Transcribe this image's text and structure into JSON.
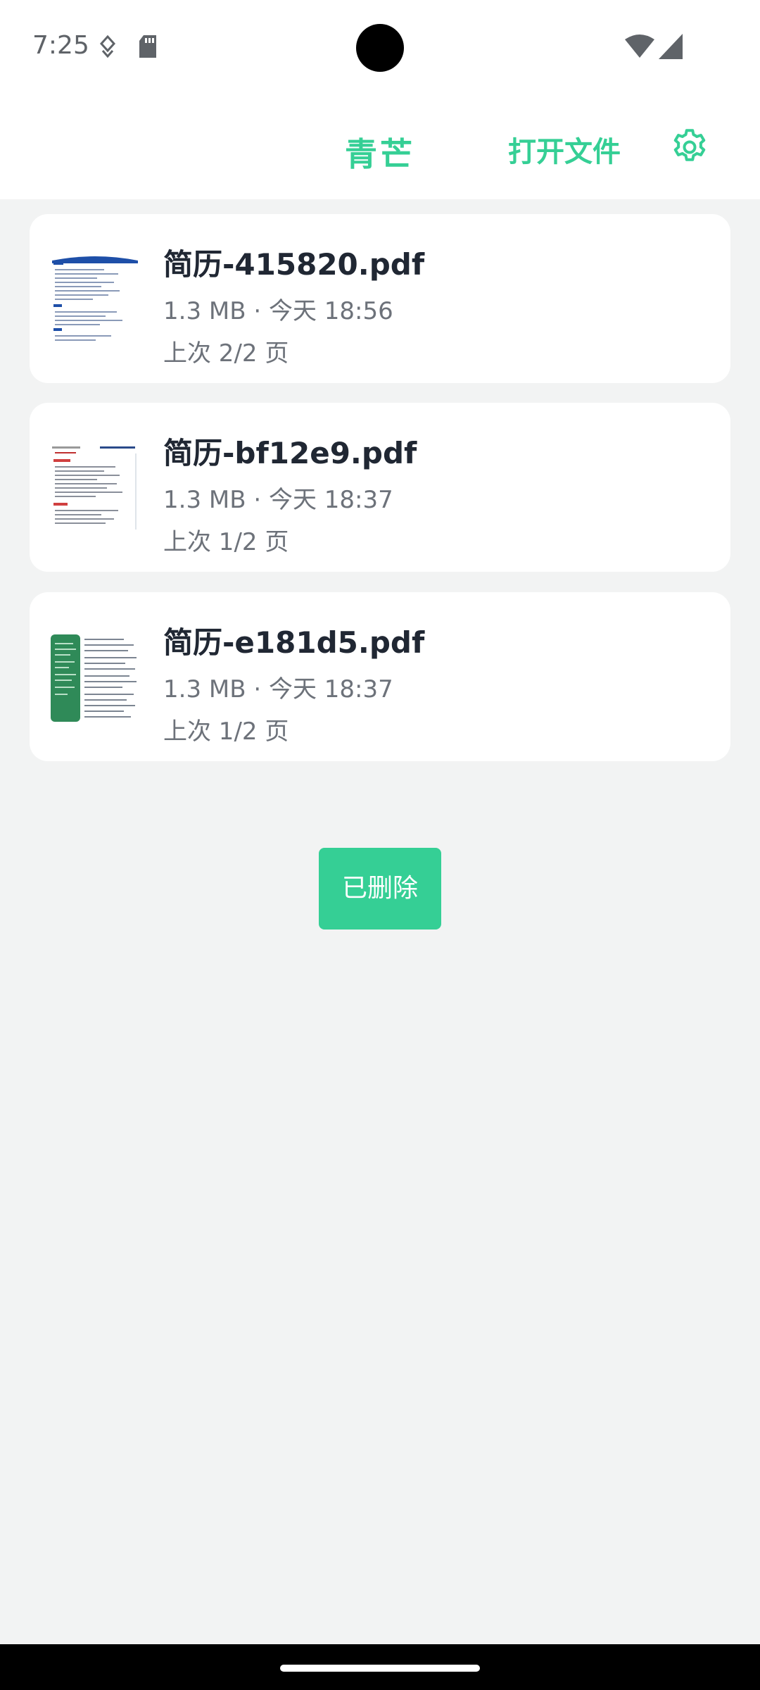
{
  "status_bar": {
    "time": "7:25",
    "icons": [
      "data-saver-icon",
      "sd-card-icon",
      "wifi-icon",
      "cell-signal-icon"
    ]
  },
  "app_bar": {
    "title": "青芒",
    "open_file_label": "打开文件",
    "settings_icon": "gear-icon",
    "accent_color": "#35cf95"
  },
  "files": [
    {
      "name": "简历-415820.pdf",
      "meta": "1.3 MB · 今天 18:56",
      "progress": "上次 2/2 页"
    },
    {
      "name": "简历-bf12e9.pdf",
      "meta": "1.3 MB · 今天 18:37",
      "progress": "上次 1/2 页"
    },
    {
      "name": "简历-e181d5.pdf",
      "meta": "1.3 MB · 今天 18:37",
      "progress": "上次 1/2 页"
    }
  ],
  "toast": {
    "text": "已删除"
  }
}
